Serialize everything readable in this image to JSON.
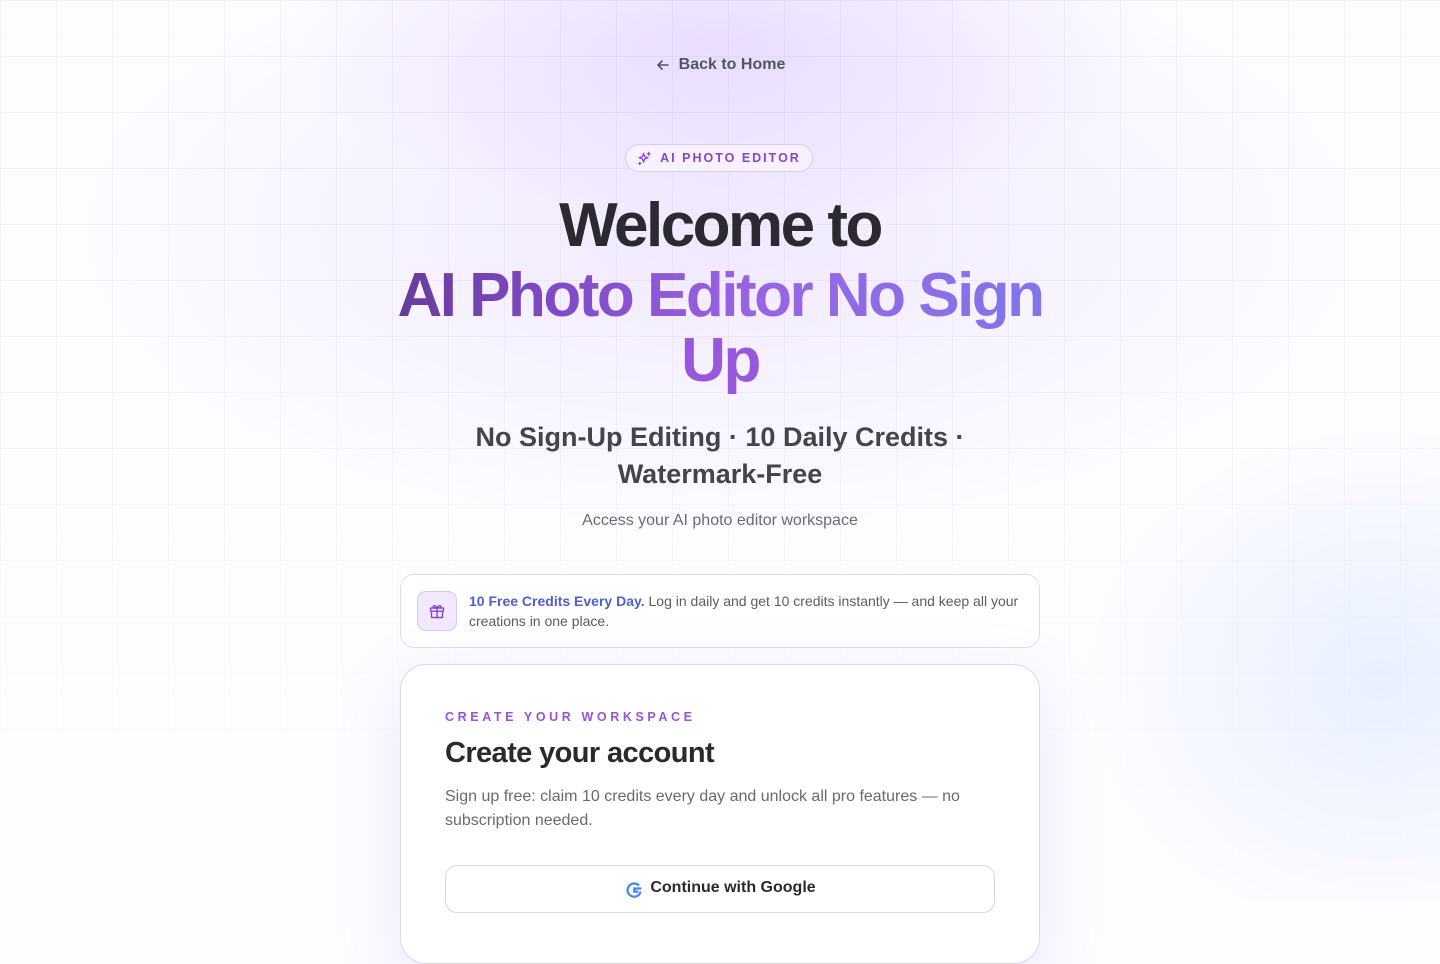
{
  "nav": {
    "back_label": "Back to Home",
    "back_icon": "arrow-left-icon"
  },
  "hero": {
    "badge_label": "AI PHOTO EDITOR",
    "badge_icon": "sparkles-icon",
    "title_line1": "Welcome to",
    "title_line2": "AI Photo Editor No Sign",
    "title_line3": "Up",
    "subtitle": "No Sign-Up Editing · 10 Daily Credits · Watermark-Free",
    "tagline": "Access your AI photo editor workspace"
  },
  "credits_banner": {
    "icon": "gift-icon",
    "highlight": "10 Free Credits Every Day.",
    "text": "Log in daily and get 10 credits instantly — and keep all your creations in one place."
  },
  "signup_card": {
    "eyebrow": "CREATE YOUR WORKSPACE",
    "title": "Create your account",
    "description": "Sign up free: claim 10 credits every day and unlock all pro features — no subscription needed.",
    "google_button_label": "Continue with Google",
    "google_icon": "google-logo-icon"
  },
  "colors": {
    "accent_purple": "#9857dc",
    "accent_blue": "#5e95ea",
    "banner_highlight": "#4f5fc7",
    "text_dark": "#2c2a30"
  }
}
